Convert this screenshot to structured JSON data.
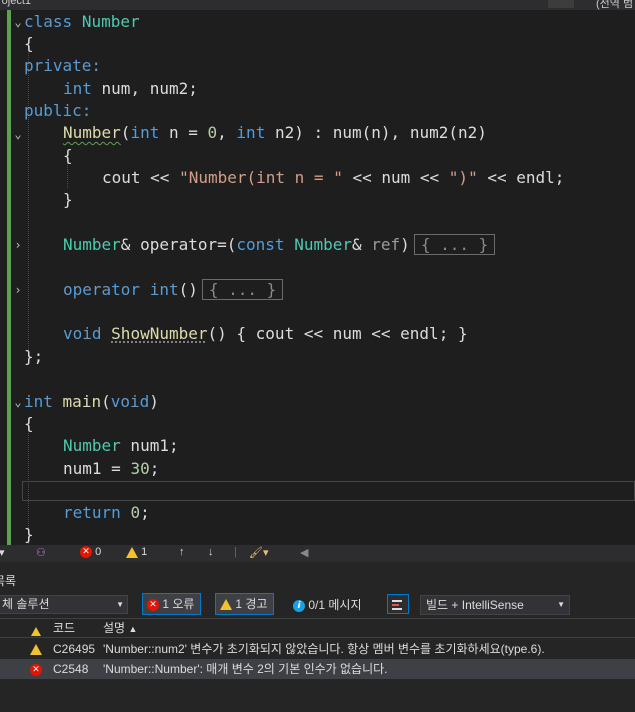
{
  "topbar": {
    "project_label": "roject1",
    "right_label": "(전역 범"
  },
  "editor": {
    "line1": {
      "kw": "class",
      "name": "Number"
    },
    "line2": "{",
    "line3": "private:",
    "line4": {
      "kw": "int",
      "rest": " num, num2;"
    },
    "line5": "public:",
    "line6": {
      "fn": "Number",
      "p1": "(",
      "kw1": "int",
      "t1": " n = ",
      "n1": "0",
      "t2": ", ",
      "kw2": "int",
      "t3": " n2) : num(n), num2(n2)"
    },
    "line7": "{",
    "line8": {
      "a": "cout << ",
      "s1": "\"Number(int n = \"",
      "b": " << num << ",
      "s2": "\")\"",
      "c": " << endl;"
    },
    "line9": "}",
    "line10": {
      "ty1": "Number",
      "a": "& operator=(",
      "kw": "const",
      "b": " ",
      "ty2": "Number",
      "c": "& ",
      "pm": "ref",
      "d": ")",
      "collapsed": "{ ... }"
    },
    "line11": {
      "kw1": "operator",
      "a": " ",
      "kw2": "int",
      "b": "()",
      "collapsed": "{ ... }"
    },
    "line12": {
      "kw": "void",
      "a": " ",
      "fn": "ShowNumber",
      "b": "() { cout << num << endl; }"
    },
    "line13": "};",
    "line14": {
      "kw1": "int",
      "a": " ",
      "fn": "main",
      "b": "(",
      "kw2": "void",
      "c": ")"
    },
    "line15": "{",
    "line16": {
      "ty": "Number",
      "a": " num1;"
    },
    "line17": {
      "a": "num1 = ",
      "n": "30",
      "b": ";"
    },
    "line19": {
      "kw": "return",
      "a": " ",
      "n": "0",
      "b": ";"
    },
    "line20": "}"
  },
  "status": {
    "errors": "0",
    "warnings": "1"
  },
  "panel": {
    "title": "목록",
    "scope": "체 솔루션",
    "errors_btn": "1 오류",
    "warnings_btn": "1 경고",
    "messages_btn": "0/1 메시지",
    "build_select": "빌드 + IntelliSense",
    "columns": {
      "code": "코드",
      "description": "설명"
    },
    "rows": [
      {
        "type": "warning",
        "code": "C26495",
        "description": "'Number::num2' 변수가 초기화되지 않았습니다. 항상 멤버 변수를 초기화하세요(type.6)."
      },
      {
        "type": "error",
        "code": "C2548",
        "description": "'Number::Number': 매개 변수 2의 기본 인수가 없습니다."
      }
    ]
  },
  "colors": {
    "keyword": "#569cd6",
    "type": "#4ec9b0",
    "function": "#dcdcaa",
    "string": "#d69d85",
    "number": "#b5cea8",
    "accent": "#007acc",
    "error": "#e51400",
    "warning": "#f2c12e"
  }
}
